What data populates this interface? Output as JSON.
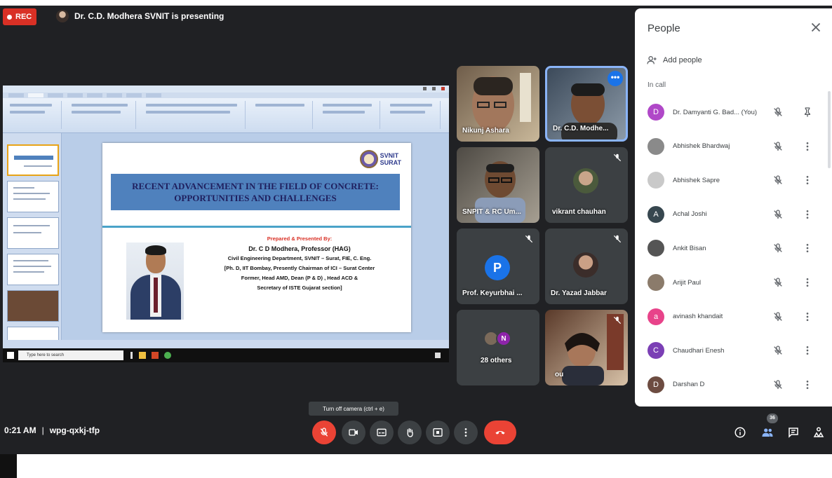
{
  "colors": {
    "meet_bg": "#202124",
    "tile_bg": "#3c4043",
    "rec_red": "#d93025",
    "end_call_red": "#ea4335",
    "accent_blue": "#1a73e8"
  },
  "top_bar": {
    "rec_label": "REC",
    "presenting_text": "Dr. C.D. Modhera SVNIT is presenting"
  },
  "slide": {
    "logo_text_1": "SVNIT",
    "logo_text_2": "SURAT",
    "title_line_1": "RECENT ADVANCEMENT IN THE FIELD OF CONCRETE:",
    "title_line_2": "OPPORTUNITIES AND CHALLENGES",
    "prepared_by": "Prepared & Presented By:",
    "presenter": "Dr. C D Modhera, Professor (HAG)",
    "line_1": "Civil Engineering Department, SVNIT – Surat, FIE, C. Eng.",
    "line_2": "[Ph. D, IIT Bombay, Presently Chairman of ICI – Surat Center",
    "line_3": "Former, Head AMD, Dean (P & D) , Head ACD &",
    "line_4": "Secretary of ISTE Gujarat section]"
  },
  "taskbar": {
    "search_placeholder": "Type here to search"
  },
  "tiles": [
    {
      "name": "Nikunj Ashara"
    },
    {
      "name": "Dr. C.D. Modhe..."
    },
    {
      "name": "SNPIT & RC Um..."
    },
    {
      "name": "vikrant chauhan"
    },
    {
      "name": "Prof. Keyurbhai ...",
      "initial": "P"
    },
    {
      "name": "Dr. Yazad Jabbar"
    },
    {
      "name": "28 others",
      "initial": "N"
    },
    {
      "name": "ou"
    }
  ],
  "toolbar": {
    "time": "0:21 AM",
    "separator": "|",
    "meeting_code": "wpg-qxkj-tfp",
    "tooltip": "Turn off camera (ctrl + e)",
    "participant_count": "36"
  },
  "people_panel": {
    "title": "People",
    "add_people": "Add people",
    "section": "In call",
    "people": [
      {
        "name": "Dr. Damyanti G. Bad... (You)",
        "initial": "D",
        "color": "#b048c8"
      },
      {
        "name": "Abhishek Bhardwaj",
        "initial": "",
        "color": "#8a8a8a"
      },
      {
        "name": "Abhishek Sapre",
        "initial": "",
        "color": "#c9c9c9"
      },
      {
        "name": "Achal Joshi",
        "initial": "A",
        "color": "#37474f"
      },
      {
        "name": "Ankit Bisan",
        "initial": "",
        "color": "#555555"
      },
      {
        "name": "Arijit Paul",
        "initial": "",
        "color": "#8b7b6b"
      },
      {
        "name": "avinash khandait",
        "initial": "a",
        "color": "#e8438a"
      },
      {
        "name": "Chaudhari Enesh",
        "initial": "C",
        "color": "#7b3fb5"
      },
      {
        "name": "Darshan D",
        "initial": "D",
        "color": "#6d4c41"
      }
    ]
  }
}
